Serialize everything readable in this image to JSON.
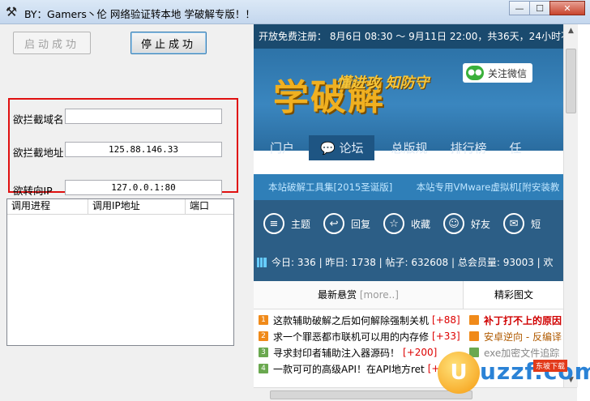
{
  "window": {
    "title": "BY：Gamers丶伦 网络验证转本地 学破解专版！！",
    "app_icon": "hammer-icon",
    "min_glyph": "—",
    "max_glyph": "☐",
    "close_glyph": "✕"
  },
  "controls": {
    "start_button": "启动成功",
    "stop_button": "停止成功",
    "domain_label": "欲拦截域名",
    "domain_value": "",
    "address_label": "欲拦截地址",
    "address_value": "125.88.146.33",
    "redirect_label": "欲转向IP",
    "redirect_value": "127.0.0.1:80"
  },
  "listview": {
    "columns": [
      "调用进程",
      "调用IP地址",
      "端口"
    ]
  },
  "browser": {
    "topbar": "开放免费注册： 8月6日 08:30 ～ 9月11日 22:00，共36天，24小时不",
    "logo_main": "学破解",
    "logo_sub": "懂进攻 知防守",
    "wechat": "关注微信",
    "wechat_icon": "wechat-icon",
    "nav": [
      "门户",
      "论坛",
      "总版规",
      "排行榜",
      "任"
    ],
    "sub_links": [
      "本站破解工具集[2015圣诞版]",
      "本站专用VMware虚拟机[附安装教"
    ],
    "icon_row": [
      {
        "icon": "theme-icon",
        "glyph": "≡",
        "label": "主题"
      },
      {
        "icon": "reply-icon",
        "glyph": "↩",
        "label": "回复"
      },
      {
        "icon": "favorite-icon",
        "glyph": "☆",
        "label": "收藏"
      },
      {
        "icon": "friend-icon",
        "glyph": "☺",
        "label": "好友"
      },
      {
        "icon": "message-icon",
        "glyph": "✉",
        "label": "短"
      }
    ],
    "stats": "今日: 336 | 昨日: 1738 | 帖子: 632608 | 总会员量: 93003 | 欢",
    "tab1": "最新悬赏",
    "tab1_more": "[more..]",
    "tab2": "精彩图文",
    "threads": [
      {
        "n": "1",
        "text": "这款辅助破解之后如何解除强制关机",
        "count": "[+88]"
      },
      {
        "n": "2",
        "text": "求一个罪恶都市联机可以用的内存修",
        "count": "[+33]"
      },
      {
        "n": "3",
        "text": "寻求封印者辅助注入器源码！",
        "count": "[+200]"
      },
      {
        "n": "4",
        "text": "一款可可的高级API！在API地方ret",
        "count": "[+10]"
      }
    ],
    "threads2": [
      {
        "text": "补丁打不上的原因",
        "color": "#d00000"
      },
      {
        "text": "安卓逆向 - 反编译",
        "color": "#b05a00"
      },
      {
        "text": "exe加密文件追踪",
        "color": "#888888"
      },
      {
        "text": "",
        "color": "#333333"
      }
    ]
  },
  "watermark": {
    "mark": "U",
    "text": "uzzf.com",
    "sub": "东坡下载"
  }
}
